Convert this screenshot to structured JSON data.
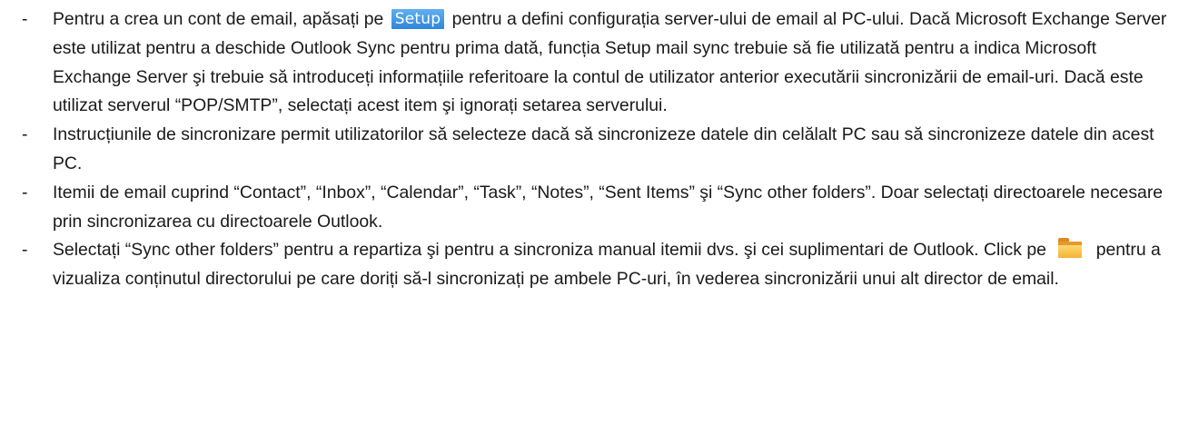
{
  "document": {
    "bullet_marker": "-",
    "items": [
      {
        "before": "Pentru a crea un cont de email, apăsați pe",
        "button": "Setup",
        "after": "pentru a defini configurația server-ului de email al PC-ului. Dacă Microsoft Exchange Server este utilizat pentru a deschide Outlook Sync pentru prima dată, funcția Setup mail sync trebuie să fie utilizată pentru a indica Microsoft Exchange Server şi trebuie să introduceți informațiile referitoare la contul de utilizator anterior executării sincronizării de email-uri. Dacă este utilizat serverul “POP/SMTP”, selectați acest item şi ignorați setarea serverului."
      },
      {
        "text": "Instrucțiunile de sincronizare permit utilizatorilor să selecteze dacă să sincronizeze datele din celălalt PC sau să sincronizeze datele din acest PC."
      },
      {
        "text": "Itemii de email cuprind “Contact”, “Inbox”, “Calendar”, “Task”, “Notes”, “Sent Items” şi “Sync other folders”. Doar selectați directoarele necesare prin sincronizarea cu directoarele Outlook."
      },
      {
        "before": "Selectați “Sync other folders” pentru a repartiza şi pentru a sincroniza manual itemii dvs. şi cei suplimentari de Outlook. Click pe",
        "icon": "folder-icon",
        "after": "pentru a vizualiza conținutul directorului pe care doriți să-l sincronizați pe ambele PC-uri, în vederea sincronizării unui alt director de email."
      }
    ]
  }
}
